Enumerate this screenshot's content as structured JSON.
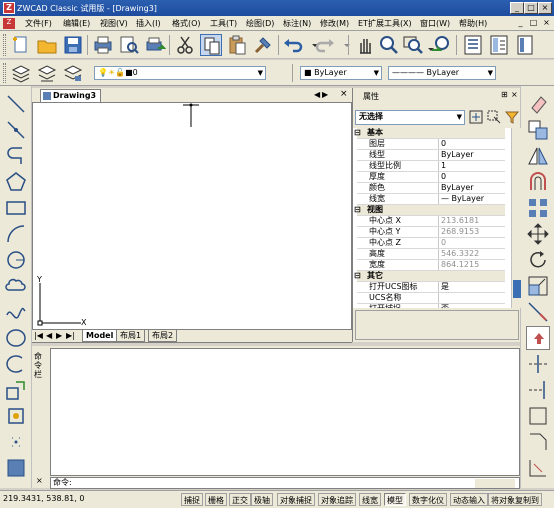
{
  "window": {
    "title": "ZWCAD Classic 试用版 - [Drawing3]",
    "buttons": [
      "_",
      "□",
      "×"
    ]
  },
  "menu": {
    "items": [
      "文件(F)",
      "编辑(E)",
      "视图(V)",
      "插入(I)",
      "格式(O)",
      "工具(T)",
      "绘图(D)",
      "标注(N)",
      "修改(M)",
      "ET扩展工具(X)",
      "窗口(W)",
      "帮助(H)"
    ],
    "doc_controls": [
      "_",
      "□",
      "×"
    ]
  },
  "toolbar2": {
    "layer_value": "0",
    "color_value": "ByLayer",
    "linetype_value": "ByLayer"
  },
  "drawing": {
    "tab_title": "Drawing3",
    "tab_controls": [
      "◀",
      "▶",
      "×"
    ],
    "ucs_x": "X",
    "ucs_y": "Y",
    "layout_tabs": [
      "Model",
      "布局1",
      "布局2"
    ],
    "nav_buttons": [
      "|◀",
      "◀",
      "▶",
      "▶|"
    ]
  },
  "properties": {
    "panel_title": "属性",
    "selection": "无选择",
    "controls": [
      "⊞",
      "×"
    ],
    "categories": [
      {
        "name": "基本",
        "rows": [
          [
            "图层",
            "0"
          ],
          [
            "线型",
            "ByLayer"
          ],
          [
            "线型比例",
            "1"
          ],
          [
            "厚度",
            "0"
          ],
          [
            "颜色",
            "ByLayer"
          ],
          [
            "线宽",
            "— ByLayer"
          ]
        ]
      },
      {
        "name": "视图",
        "rows": [
          [
            "中心点 X",
            "213.6181"
          ],
          [
            "中心点 Y",
            "268.9153"
          ],
          [
            "中心点 Z",
            "0"
          ],
          [
            "高度",
            "546.3322"
          ],
          [
            "宽度",
            "864.1215"
          ]
        ]
      },
      {
        "name": "其它",
        "rows": [
          [
            "打开UCS图标",
            "是"
          ],
          [
            "UCS名称",
            ""
          ],
          [
            "打开捕捉",
            "否"
          ]
        ]
      }
    ],
    "side_label": "命令栏"
  },
  "command": {
    "prompt": "命令:",
    "side_label": "命令栏",
    "close": "×"
  },
  "status": {
    "coords": "219.3431,  538.81,  0",
    "toggles": [
      "捕捉",
      "栅格",
      "正交",
      "极轴",
      "对象捕捉",
      "对象追踪",
      "线宽",
      "模型",
      "数字化仪",
      "动态输入",
      "将对象复制到"
    ],
    "active": [
      "模型"
    ]
  },
  "colors": {
    "title_bg": "#1E4C9E",
    "accent": "#2B5FB0"
  }
}
